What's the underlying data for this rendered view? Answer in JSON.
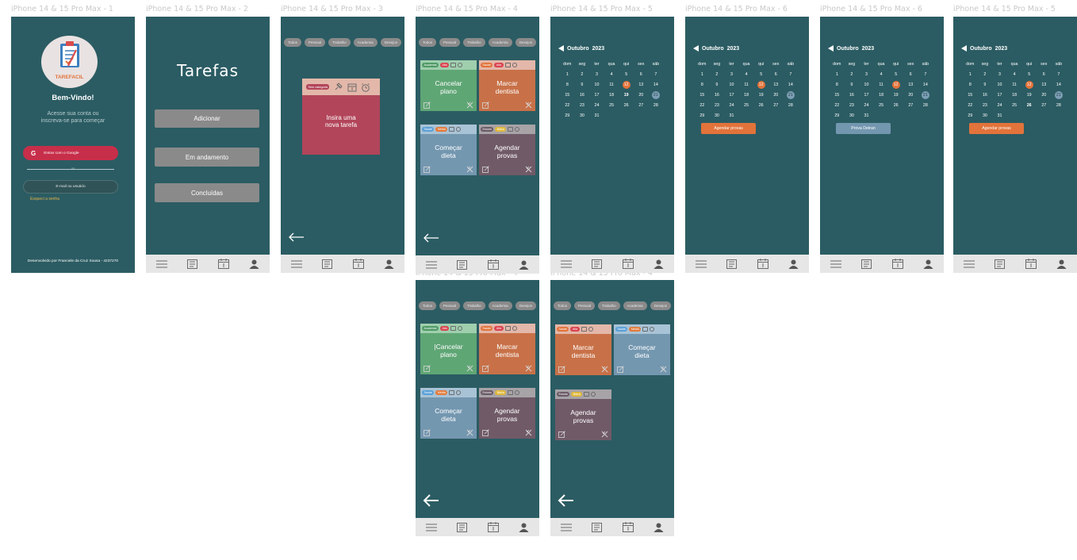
{
  "frame_labels": [
    "iPhone 14 & 15 Pro Max - 1",
    "iPhone 14 & 15 Pro Max - 2",
    "iPhone 14 & 15 Pro Max - 3",
    "iPhone 14 & 15 Pro Max - 4",
    "iPhone 14 & 15 Pro Max - 5",
    "iPhone 14 & 15 Pro Max - 6",
    "iPhone 14 & 15 Pro Max - 6",
    "iPhone 14 & 15 Pro Max - 5",
    "iPhone 14 & 15 Pro Max - 4",
    "iPhone 14 & 15 Pro Max - 4"
  ],
  "colors": {
    "bg": "#2b5c63",
    "nav": "#e6e6e6",
    "green": "#5fa675",
    "orange": "#c87148",
    "blue": "#7497b0",
    "mauve": "#705a67",
    "pink": "#b2455a",
    "accent": "#e2733a"
  },
  "login": {
    "logo_text": "TAREFACIL",
    "welcome": "Bem-Vindo!",
    "subtitle_line1": "Acesse sua conta ou",
    "subtitle_line2": "inscreva-se para começar",
    "google_button": "Entrar com o Google",
    "divider": "ou",
    "email_button": "E-mail ou usuário",
    "forgot": "Esqueci a senha",
    "footer": "Desenvolvido por Franciele da Cruz Sousa - 4237270"
  },
  "home": {
    "title": "Tarefas",
    "add": "Adicionar",
    "in_progress": "Em andamento",
    "done": "Concluídas"
  },
  "categories": [
    "Todos",
    "Pessoal",
    "Trabalho",
    "Academia",
    "Desejos"
  ],
  "new_task": {
    "tag": "Sem categoria",
    "text_line1": "Insira uma",
    "text_line2": "nova tarefa"
  },
  "tasks": {
    "cancelar": {
      "cat": "Academia",
      "prio": "Alta",
      "line1": "Cancelar",
      "line2": "plano",
      "cursor_line1": "|Cancelar"
    },
    "marcar": {
      "cat": "Saúde",
      "prio": "Alta",
      "line1": "Marcar",
      "line2": "dentista"
    },
    "comecar": {
      "cat": "Saúde",
      "prio": "Média",
      "line1": "Começar",
      "line2": "dieta"
    },
    "agendar": {
      "cat": "Estudo",
      "prio": "Baixa",
      "line1": "Agendar",
      "line2": "provas"
    }
  },
  "calendar": {
    "month": "Outubro",
    "year": "2023",
    "weekdays": [
      "dom",
      "seg",
      "ter",
      "qua",
      "qui",
      "sex",
      "sáb"
    ],
    "weeks": [
      [
        "1",
        "2",
        "3",
        "4",
        "5",
        "6",
        "7"
      ],
      [
        "8",
        "9",
        "10",
        "11",
        "12",
        "13",
        "14"
      ],
      [
        "15",
        "16",
        "17",
        "18",
        "19",
        "20",
        "21"
      ],
      [
        "22",
        "23",
        "24",
        "25",
        "26",
        "27",
        "28"
      ],
      [
        "29",
        "30",
        "31",
        "",
        "",
        "",
        ""
      ]
    ],
    "today": "12",
    "selected": "21",
    "event_agendar": "Agendar provas",
    "event_detran": "Prova Detran"
  }
}
